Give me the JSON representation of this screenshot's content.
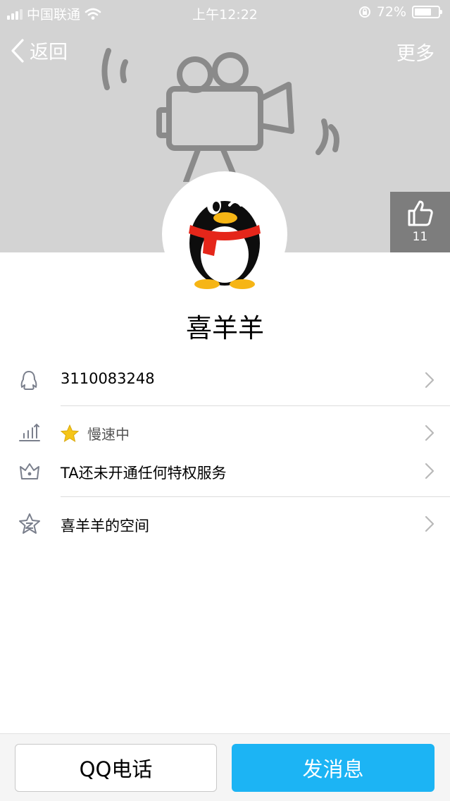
{
  "status_bar": {
    "carrier": "中国联通",
    "time": "上午12:22",
    "battery": "72%",
    "battery_level": 0.72
  },
  "nav": {
    "back_label": "返回",
    "more_label": "更多"
  },
  "like": {
    "count": "11"
  },
  "profile": {
    "nickname": "喜羊羊"
  },
  "rows": {
    "qq_number": "3110083248",
    "speed_status": "慢速中",
    "privilege": "TA还未开通任何特权服务",
    "space": "喜羊羊的空间"
  },
  "buttons": {
    "call": "QQ电话",
    "message": "发消息"
  },
  "colors": {
    "cover_bg": "#d3d3d3",
    "accent_blue": "#1cb4f4",
    "like_bg": "#7d7d7d",
    "icon_gray": "#7a7f8c"
  }
}
